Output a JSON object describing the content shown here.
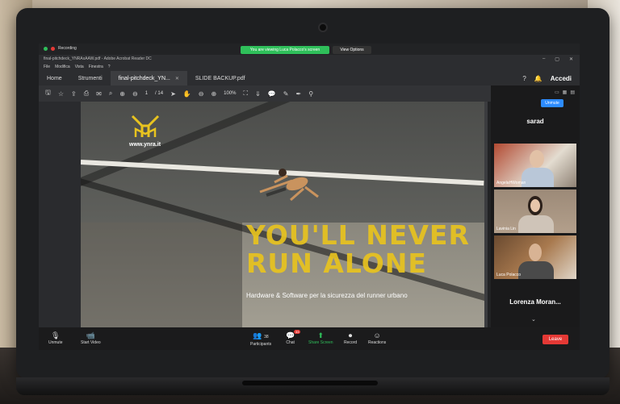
{
  "zoom": {
    "recording_label": "Recording",
    "share_banner": "You are viewing Luca Polacco's screen",
    "view_options": "View Options",
    "bottom_bar": {
      "unmute": "Unmute",
      "start_video": "Start Video",
      "participants": "Participants",
      "participants_count": "38",
      "chat": "Chat",
      "chat_badge": "33",
      "share_screen": "Share Screen",
      "record": "Record",
      "reactions": "Reactions",
      "leave": "Leave"
    },
    "panel": {
      "unmute_chip": "Unmute",
      "main_name": "sarad",
      "participants": [
        {
          "name": "AngelaHWoman"
        },
        {
          "name": "Lavinia Lin"
        },
        {
          "name": "Luca Polacco"
        }
      ],
      "bottom_name": "Lorenza Moran..."
    }
  },
  "acrobat": {
    "window_title": "final-pitchdeck_YNRAxAAW.pdf - Adobe Acrobat Reader DC",
    "menu": [
      "File",
      "Modifica",
      "Vista",
      "Finestra",
      "?"
    ],
    "tabs": {
      "home": "Home",
      "tools": "Strumenti",
      "doc1": "final-pitchdeck_YN...",
      "doc2": "SLIDE BACKUP.pdf"
    },
    "signin": "Accedi",
    "toolbar": {
      "page_current": "1",
      "page_total": "/ 14",
      "zoom": "100%"
    }
  },
  "slide": {
    "site": "www.ynra.it",
    "headline_line1": "YOU'LL NEVER",
    "headline_line2": "RUN ALONE",
    "tagline": "Hardware & Software per la sicurezza del runner urbano",
    "accent_color": "#e8c31f"
  }
}
